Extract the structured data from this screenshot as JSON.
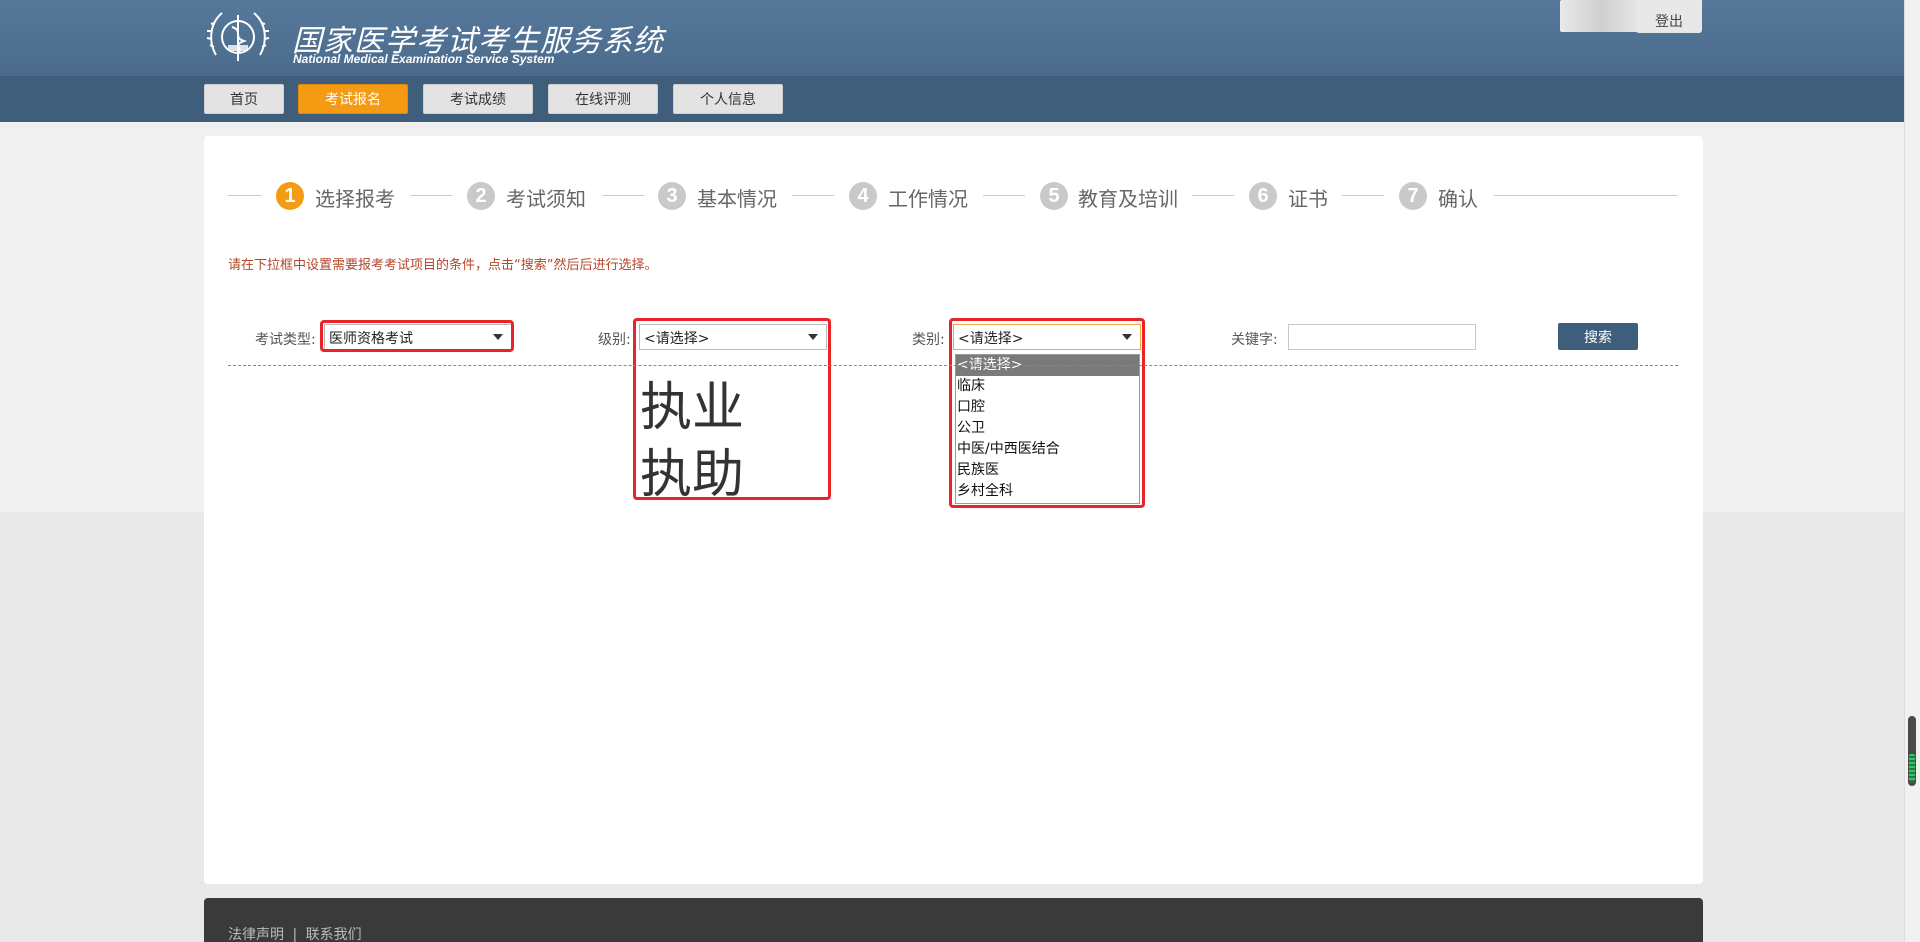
{
  "header": {
    "title": "国家医学考试考生服务系统",
    "subtitle": "National Medical Examination Service System",
    "logout_label": "登出",
    "logo_icon": "medical-emblem-icon"
  },
  "nav": {
    "items": [
      {
        "label": "首页",
        "active": false
      },
      {
        "label": "考试报名",
        "active": true
      },
      {
        "label": "考试成绩",
        "active": false
      },
      {
        "label": "在线评测",
        "active": false
      },
      {
        "label": "个人信息",
        "active": false
      }
    ]
  },
  "steps": [
    {
      "num": "1",
      "label": "选择报考",
      "active": true
    },
    {
      "num": "2",
      "label": "考试须知",
      "active": false
    },
    {
      "num": "3",
      "label": "基本情况",
      "active": false
    },
    {
      "num": "4",
      "label": "工作情况",
      "active": false
    },
    {
      "num": "5",
      "label": "教育及培训",
      "active": false
    },
    {
      "num": "6",
      "label": "证书",
      "active": false
    },
    {
      "num": "7",
      "label": "确认",
      "active": false
    }
  ],
  "hint": "请在下拉框中设置需要报考考试项目的条件，点击“搜索”然后后进行选择。",
  "filters": {
    "exam_type": {
      "label": "考试类型:",
      "value": "医师资格考试"
    },
    "level": {
      "label": "级别:",
      "value": "<请选择>",
      "options": [
        "执业",
        "执助"
      ]
    },
    "category": {
      "label": "类别:",
      "value": "<请选择>",
      "options": [
        "<请选择>",
        "临床",
        "口腔",
        "公卫",
        "中医/中西医结合",
        "民族医",
        "乡村全科"
      ]
    },
    "keyword": {
      "label": "关键字:",
      "value": ""
    },
    "search_label": "搜索"
  },
  "footer": {
    "legal": "法律声明",
    "separator": "|",
    "contact": "联系我们"
  },
  "colors": {
    "header": "#4a6b8c",
    "accent": "#f59b13",
    "highlight": "#e8242a",
    "hint": "#b4462a"
  }
}
